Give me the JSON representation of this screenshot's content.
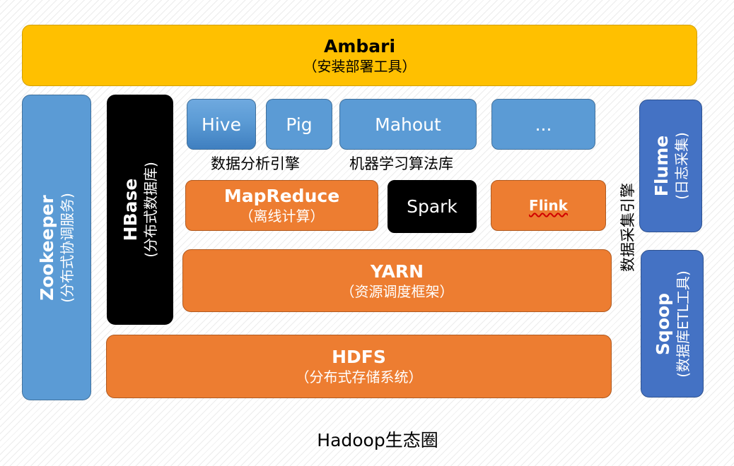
{
  "ambari": {
    "title": "Ambari",
    "subtitle": "（安装部署工具）"
  },
  "zookeeper": {
    "title": "Zookeeper",
    "subtitle": "(分布式协调服务)"
  },
  "hbase": {
    "title": "HBase",
    "subtitle": "(分布式数据库)"
  },
  "hive": {
    "label": "Hive"
  },
  "pig": {
    "label": "Pig"
  },
  "mahout": {
    "label": "Mahout"
  },
  "more": {
    "label": "..."
  },
  "captions": {
    "analysis": "数据分析引擎",
    "ml": "机器学习算法库",
    "collection": "数据采集引擎"
  },
  "mapreduce": {
    "title": "MapReduce",
    "subtitle": "（离线计算）"
  },
  "spark": {
    "label": "Spark"
  },
  "flink": {
    "label": "Flink"
  },
  "yarn": {
    "title": "YARN",
    "subtitle": "（资源调度框架）"
  },
  "hdfs": {
    "title": "HDFS",
    "subtitle": "（分布式存储系统）"
  },
  "flume": {
    "title": "Flume",
    "subtitle": "(日志采集)"
  },
  "sqoop": {
    "title": "Sqoop",
    "subtitle": "(数据库ETL工具)"
  },
  "footer": {
    "caption": "Hadoop生态圈"
  },
  "colors": {
    "yellow": "#ffc000",
    "orange": "#ed7d31",
    "blue": "#5b9bd5",
    "dark_blue": "#4472c4",
    "black": "#000000"
  }
}
